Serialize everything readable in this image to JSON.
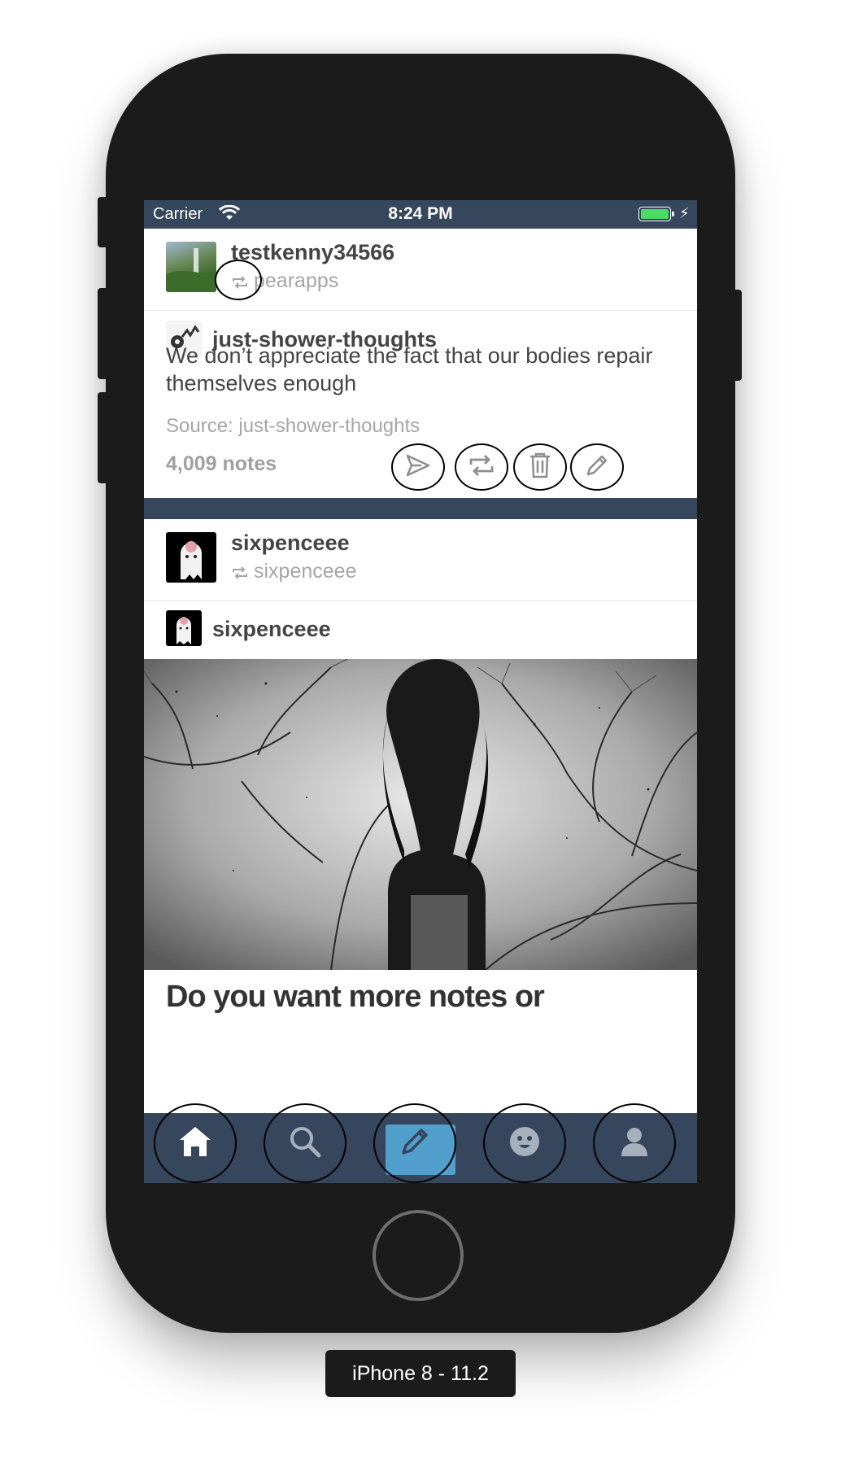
{
  "device_label": "iPhone 8 - 11.2",
  "status_bar": {
    "carrier": "Carrier",
    "time": "8:24 PM"
  },
  "post1": {
    "username": "testkenny34566",
    "reblogged_from": "pearapps",
    "blog_name": "just-shower-thoughts",
    "text": "We don’t appreciate the fact that our bodies repair themselves enough",
    "source": "Source: just-shower-thoughts",
    "notes": "4,009 notes",
    "actions": [
      "share-icon",
      "reblog-icon",
      "delete-icon",
      "edit-icon"
    ]
  },
  "post2": {
    "username": "sixpenceee",
    "reblogged_from": "sixpenceee",
    "blog_name": "sixpenceee",
    "title": "Do you want more notes or"
  },
  "tabbar": {
    "items": [
      "home-icon",
      "search-icon",
      "compose-icon",
      "activity-icon",
      "account-icon"
    ]
  },
  "colors": {
    "nav": "#36465d",
    "compose": "#529ecc",
    "battery": "#4cd964"
  }
}
